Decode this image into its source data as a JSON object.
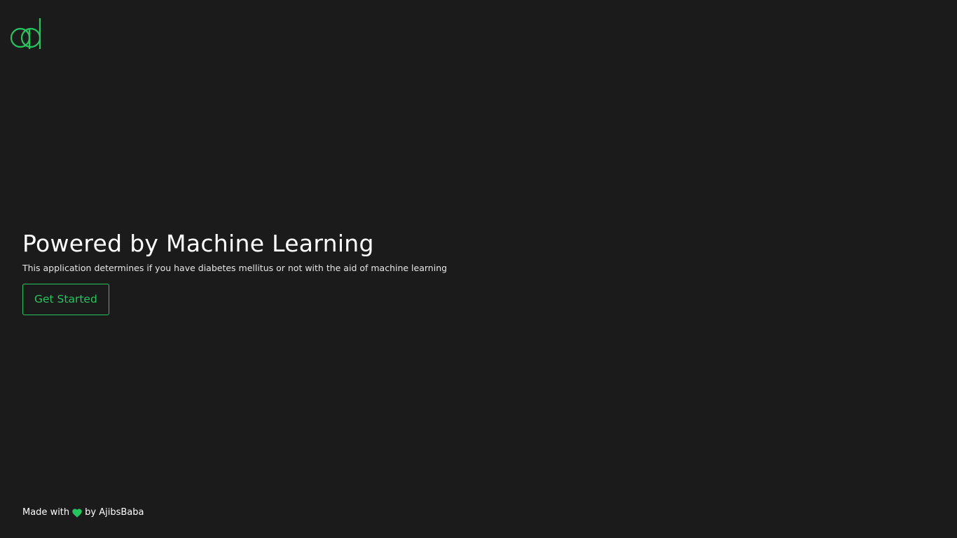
{
  "brand": {
    "logo_letters": "dd",
    "accent_color": "#22c55e",
    "background_color": "#1b1b1b"
  },
  "hero": {
    "title": "Powered by Machine Learning",
    "subtitle": "This application determines if you have diabetes mellitus or not with the aid of machine learning",
    "cta_label": "Get Started"
  },
  "footer": {
    "made_with": "Made with",
    "heart_icon": "heart-icon",
    "by_author": "by AjibsBaba"
  }
}
